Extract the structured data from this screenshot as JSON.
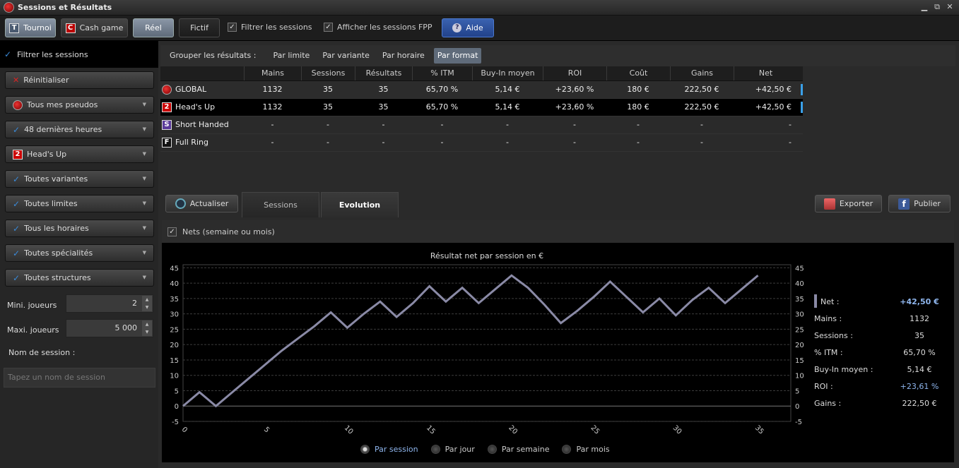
{
  "window": {
    "title": "Sessions et Résultats"
  },
  "toolbar": {
    "tournoi": "Tournoi",
    "tournoi_letter": "T",
    "cash": "Cash game",
    "cash_letter": "C",
    "reel": "Réel",
    "fictif": "Fictif",
    "filtrer": "Filtrer les sessions",
    "fpp": "Afficher les sessions FPP",
    "aide": "Aide"
  },
  "sidebar": {
    "header": "Filtrer les sessions",
    "reset": "Réinitialiser",
    "pseudos": "Tous mes pseudos",
    "period": "48 dernières heures",
    "format": "Head's Up",
    "format_letter": "2",
    "variantes": "Toutes variantes",
    "limites": "Toutes limites",
    "horaires": "Tous les horaires",
    "specialites": "Toutes spécialités",
    "structures": "Toutes structures",
    "min_label": "Mini. joueurs",
    "min_val": "2",
    "max_label": "Maxi. joueurs",
    "max_val": "5 000",
    "name_label": "Nom de session :",
    "name_placeholder": "Tapez un nom de session"
  },
  "group": {
    "label": "Grouper les résultats :",
    "opt1": "Par limite",
    "opt2": "Par variante",
    "opt3": "Par horaire",
    "opt4": "Par format"
  },
  "table": {
    "headers": [
      "",
      "Mains",
      "Sessions",
      "Résultats",
      "% ITM",
      "Buy-In moyen",
      "ROI",
      "Coût",
      "Gains",
      "Net"
    ],
    "rows": [
      {
        "letter": "",
        "name": "GLOBAL",
        "cells": [
          "1132",
          "35",
          "35",
          "65,70 %",
          "5,14 €",
          "+23,60 %",
          "180 €",
          "222,50 €",
          "+42,50 €"
        ]
      },
      {
        "letter": "2",
        "name": "Head's Up",
        "cells": [
          "1132",
          "35",
          "35",
          "65,70 %",
          "5,14 €",
          "+23,60 %",
          "180 €",
          "222,50 €",
          "+42,50 €"
        ]
      },
      {
        "letter": "S",
        "name": "Short Handed",
        "cells": [
          "-",
          "-",
          "-",
          "-",
          "-",
          "-",
          "-",
          "-",
          "-"
        ]
      },
      {
        "letter": "F",
        "name": "Full Ring",
        "cells": [
          "-",
          "-",
          "-",
          "-",
          "-",
          "-",
          "-",
          "-",
          "-"
        ]
      }
    ]
  },
  "tabs": {
    "refresh": "Actualiser",
    "sessions": "Sessions",
    "evolution": "Evolution",
    "export": "Exporter",
    "publish": "Publier"
  },
  "chart_panel": {
    "checkbox": "Nets (semaine ou mois)"
  },
  "chart_data": {
    "type": "line",
    "title": "Résultat net par session en €",
    "x": [
      0,
      1,
      2,
      3,
      4,
      5,
      6,
      7,
      8,
      9,
      10,
      11,
      12,
      13,
      14,
      15,
      16,
      17,
      18,
      19,
      20,
      21,
      22,
      23,
      24,
      25,
      26,
      27,
      28,
      29,
      30,
      31,
      32,
      33,
      34,
      35
    ],
    "series": [
      {
        "values": [
          0,
          4.5,
          0,
          4.5,
          9,
          13.5,
          18,
          22,
          26,
          30.5,
          25.5,
          30,
          34,
          29,
          33.5,
          39,
          34,
          38.5,
          33.5,
          38,
          42.5,
          38.5,
          33,
          27,
          31,
          35.5,
          40.5,
          35.5,
          30.5,
          35,
          29.5,
          34.5,
          38.5,
          33.5,
          38,
          42.5
        ]
      }
    ],
    "xticks": [
      0,
      5,
      10,
      15,
      20,
      25,
      30,
      35
    ],
    "yticks": [
      -5,
      0,
      5,
      10,
      15,
      20,
      25,
      30,
      35,
      40,
      45
    ],
    "xlim": [
      0,
      37
    ],
    "ylim": [
      -5,
      46
    ],
    "grid": true,
    "color": "#8a8aa6"
  },
  "stats": [
    {
      "label": "Net :",
      "value": "+42,50 €"
    },
    {
      "label": "Mains :",
      "value": "1132"
    },
    {
      "label": "Sessions :",
      "value": "35"
    },
    {
      "label": "% ITM :",
      "value": "65,70 %"
    },
    {
      "label": "Buy-In moyen :",
      "value": "5,14 €"
    },
    {
      "label": "ROI :",
      "value": "+23,61 %"
    },
    {
      "label": "Gains :",
      "value": "222,50 €"
    }
  ],
  "radios": [
    "Par session",
    "Par jour",
    "Par semaine",
    "Par mois"
  ]
}
